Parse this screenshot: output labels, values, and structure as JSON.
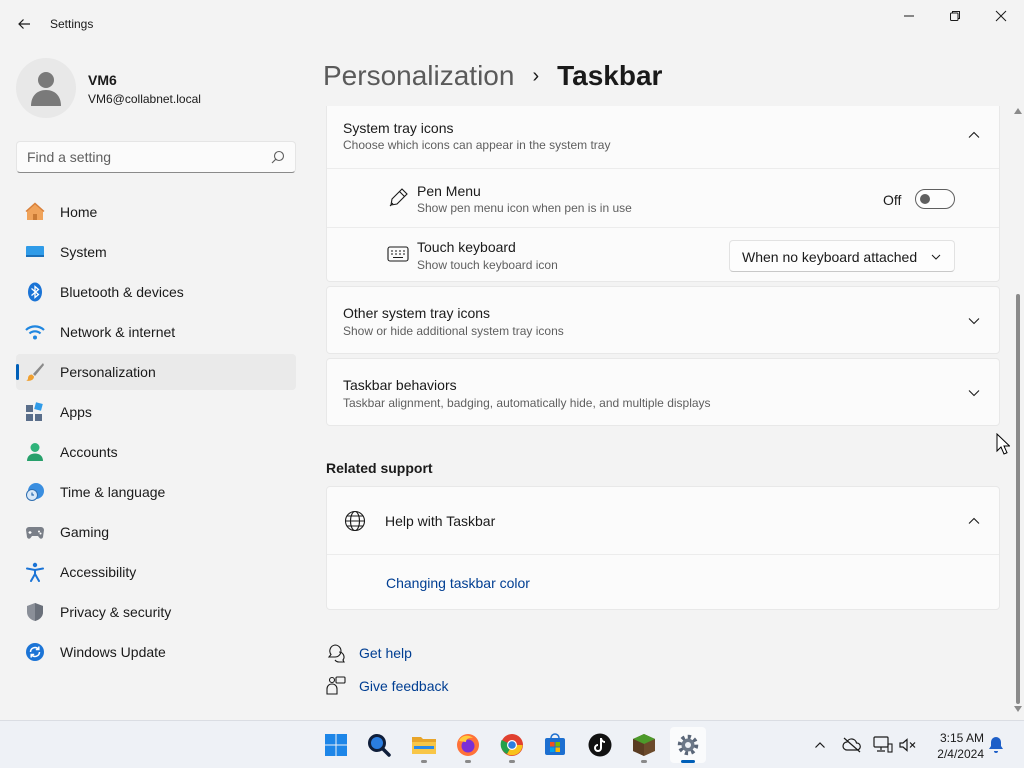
{
  "window": {
    "title": "Settings"
  },
  "profile": {
    "name": "VM6",
    "email": "VM6@collabnet.local"
  },
  "search": {
    "placeholder": "Find a setting"
  },
  "nav": {
    "items": [
      {
        "label": "Home",
        "icon": "home-icon"
      },
      {
        "label": "System",
        "icon": "system-icon"
      },
      {
        "label": "Bluetooth & devices",
        "icon": "bluetooth-icon"
      },
      {
        "label": "Network & internet",
        "icon": "wifi-icon"
      },
      {
        "label": "Personalization",
        "icon": "brush-icon",
        "active": true
      },
      {
        "label": "Apps",
        "icon": "apps-icon"
      },
      {
        "label": "Accounts",
        "icon": "accounts-icon"
      },
      {
        "label": "Time & language",
        "icon": "clock-globe-icon"
      },
      {
        "label": "Gaming",
        "icon": "gamepad-icon"
      },
      {
        "label": "Accessibility",
        "icon": "accessibility-icon"
      },
      {
        "label": "Privacy & security",
        "icon": "shield-icon"
      },
      {
        "label": "Windows Update",
        "icon": "update-icon"
      }
    ]
  },
  "header": {
    "parent": "Personalization",
    "separator": "›",
    "current": "Taskbar"
  },
  "system_tray": {
    "title": "System tray icons",
    "description": "Choose which icons can appear in the system tray",
    "pen_menu": {
      "title": "Pen Menu",
      "description": "Show pen menu icon when pen is in use",
      "state_label": "Off"
    },
    "touch_keyboard": {
      "title": "Touch keyboard",
      "description": "Show touch keyboard icon",
      "selected": "When no keyboard attached"
    }
  },
  "other_tray": {
    "title": "Other system tray icons",
    "description": "Show or hide additional system tray icons"
  },
  "behaviors": {
    "title": "Taskbar behaviors",
    "description": "Taskbar alignment, badging, automatically hide, and multiple displays"
  },
  "related_support": {
    "heading": "Related support",
    "help_title": "Help with Taskbar",
    "link": "Changing taskbar color"
  },
  "bottom_links": {
    "get_help": "Get help",
    "give_feedback": "Give feedback"
  },
  "taskbar": {
    "apps": [
      "start-icon",
      "search-icon",
      "file-explorer-icon",
      "firefox-icon",
      "chrome-icon",
      "store-icon",
      "tiktok-icon",
      "minecraft-icon",
      "settings-icon"
    ],
    "time": "3:15 AM",
    "date": "2/4/2024"
  },
  "colors": {
    "accent": "#005fb8",
    "link": "#003e92"
  }
}
